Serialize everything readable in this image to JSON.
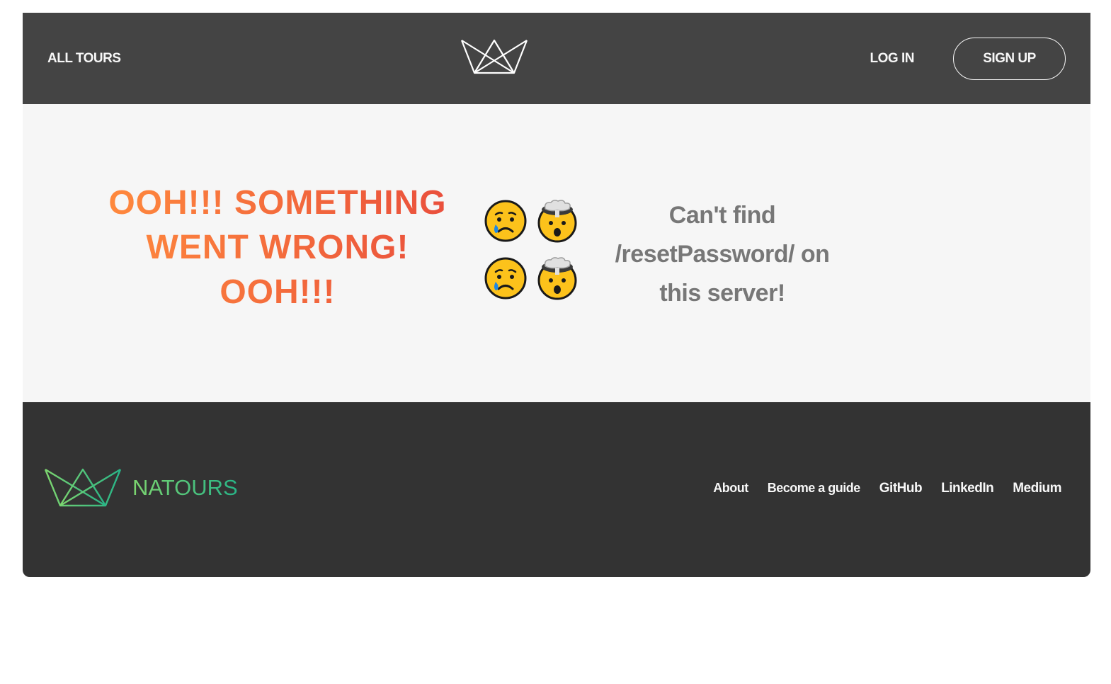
{
  "header": {
    "all_tours": "ALL TOURS",
    "login": "LOG IN",
    "signup": "SIGN UP",
    "logo_icon": "crown-logo-icon"
  },
  "error": {
    "title": "OOH!!! SOMETHING WENT WRONG! OOH!!!",
    "message": "Can't find /resetPassword/ on this server!",
    "emojis": [
      "sad-crying-face-icon",
      "exploding-head-icon",
      "sad-crying-face-icon",
      "exploding-head-icon"
    ]
  },
  "footer": {
    "brand": "NATOURS",
    "logo_icon": "crown-logo-icon",
    "links": [
      "About",
      "Become a guide",
      "GitHub",
      "LinkedIn",
      "Medium"
    ]
  },
  "colors": {
    "header_bg": "#444444",
    "footer_bg": "#333333",
    "main_bg": "#f6f6f6",
    "error_gradient": [
      "#ff8a3d",
      "#e94e3c"
    ],
    "brand_gradient": [
      "#7dd56f",
      "#28b487"
    ]
  }
}
